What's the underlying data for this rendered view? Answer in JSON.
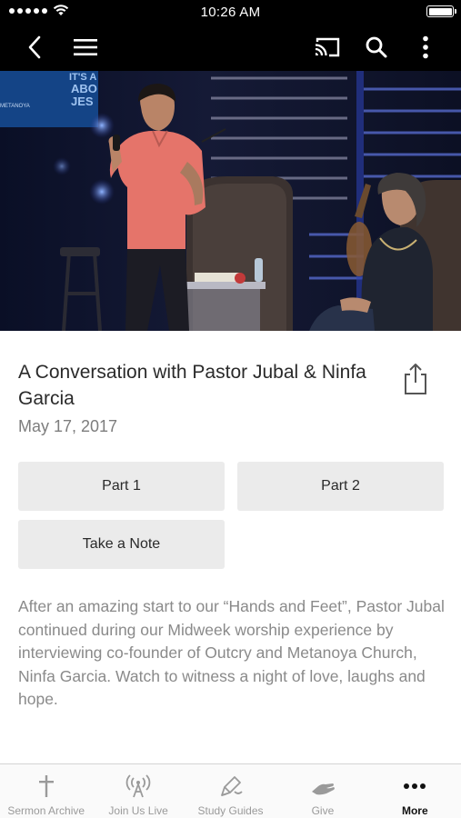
{
  "status_bar": {
    "time": "10:26 AM"
  },
  "nav_bar": {
    "icons": [
      "back-chevron-icon",
      "hamburger-menu-icon",
      "cast-icon",
      "search-icon",
      "more-vertical-icon"
    ]
  },
  "hero": {
    "screen_text": [
      "IT'S A",
      "ABO",
      "JES"
    ],
    "screen_small_text": "METANOYA"
  },
  "sermon": {
    "title": "A Conversation with Pastor Jubal & Ninfa Garcia",
    "date": "May 17, 2017",
    "buttons": {
      "part1": "Part 1",
      "part2": "Part 2",
      "note": "Take a Note"
    },
    "description": "After an amazing start to our “Hands and Feet”, Pastor Jubal continued during our Midweek worship experience by interviewing co-founder of Outcry and Metanoya Church, Ninfa Garcia. Watch to witness a night of love, laughs and hope."
  },
  "tab_bar": {
    "tabs": [
      {
        "label": "Sermon Archive",
        "icon": "cross-icon",
        "active": false
      },
      {
        "label": "Join Us Live",
        "icon": "broadcast-icon",
        "active": false
      },
      {
        "label": "Study Guides",
        "icon": "pen-icon",
        "active": false
      },
      {
        "label": "Give",
        "icon": "give-hand-icon",
        "active": false
      },
      {
        "label": "More",
        "icon": "more-dots-icon",
        "active": true
      }
    ]
  },
  "colors": {
    "bar_background": "#000000",
    "button_background": "#ebebeb",
    "muted_text": "#8a8a8a",
    "active_tab": "#111111"
  }
}
